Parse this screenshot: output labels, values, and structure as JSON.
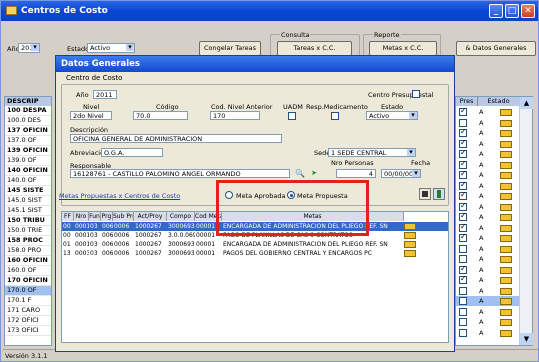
{
  "window": {
    "title": "Centros de Costo"
  },
  "toolbar": {
    "anio_label": "Año",
    "anio_value": "2011",
    "estado_label": "Estado",
    "estado_value": "Activo",
    "btn_congelar": "Congelar Tareas",
    "consulta_label": "Consulta",
    "btn_tareas": "Tareas x C.C.",
    "reporte_label": "Reporte",
    "btn_metas": "Metas x C.C.",
    "btn_datos_generales": "& Datos Generales"
  },
  "left_list": {
    "header": "DESCRIP",
    "rows": [
      {
        "text": "100 DESPA",
        "bold": true
      },
      {
        "text": "100.0 DES",
        "bold": false
      },
      {
        "text": "137 OFICIN",
        "bold": true
      },
      {
        "text": "137.0 OF",
        "bold": false
      },
      {
        "text": "139 OFICIN",
        "bold": true
      },
      {
        "text": "139.0 OF",
        "bold": false
      },
      {
        "text": "140 OFICIN",
        "bold": true
      },
      {
        "text": "140.0 OF",
        "bold": false
      },
      {
        "text": "145 SISTE",
        "bold": true
      },
      {
        "text": "145.0 SIST",
        "bold": false
      },
      {
        "text": "145.1 SIST",
        "bold": false
      },
      {
        "text": "150 TRIBU",
        "bold": true
      },
      {
        "text": "150.0 TRIE",
        "bold": false
      },
      {
        "text": "158 PROC",
        "bold": true
      },
      {
        "text": "158.0 PRO",
        "bold": false
      },
      {
        "text": "160 OFICIN",
        "bold": true
      },
      {
        "text": "160.0 OF",
        "bold": false
      },
      {
        "text": "170 OFICIN",
        "bold": true
      },
      {
        "text": "170.0 OF",
        "bold": false,
        "selected": true
      },
      {
        "text": "170.1 F",
        "bold": false
      },
      {
        "text": "171 CARO",
        "bold": false
      },
      {
        "text": "172 OFICI",
        "bold": false
      },
      {
        "text": "173 OFICI",
        "bold": false
      }
    ]
  },
  "right_list": {
    "header_pres": "Pres",
    "header_estado": "Estado",
    "rows": [
      {
        "checked": true,
        "estado": "A"
      },
      {
        "checked": false,
        "estado": "A"
      },
      {
        "checked": true,
        "estado": "A"
      },
      {
        "checked": true,
        "estado": "A"
      },
      {
        "checked": true,
        "estado": "A"
      },
      {
        "checked": true,
        "estado": "A"
      },
      {
        "checked": true,
        "estado": "A"
      },
      {
        "checked": true,
        "estado": "A"
      },
      {
        "checked": true,
        "estado": "A"
      },
      {
        "checked": true,
        "estado": "A"
      },
      {
        "checked": true,
        "estado": "A"
      },
      {
        "checked": true,
        "estado": "A"
      },
      {
        "checked": true,
        "estado": "A"
      },
      {
        "checked": false,
        "estado": "A"
      },
      {
        "checked": false,
        "estado": "A"
      },
      {
        "checked": true,
        "estado": "A"
      },
      {
        "checked": true,
        "estado": "A"
      },
      {
        "checked": false,
        "estado": "A"
      },
      {
        "checked": false,
        "estado": "A"
      },
      {
        "checked": false,
        "estado": "A"
      },
      {
        "checked": false,
        "estado": "A"
      },
      {
        "checked": false,
        "estado": "A"
      }
    ]
  },
  "status": {
    "version": "Versión 3.1.1"
  },
  "dialog": {
    "title": "Datos Generales",
    "group_label": "Centro de Costo",
    "anio_label": "Año",
    "anio_value": "2011",
    "centro_presupuestal_label": "Centro Presupuestal",
    "nivel_label": "Nivel",
    "nivel_value": "2do Nivel",
    "codigo_label": "Código",
    "codigo_value": "70.0",
    "cod_nivel_anterior_label": "Cod. Nivel Anterior",
    "cod_nivel_anterior_value": "170",
    "uadm_label": "UADM",
    "resp_medicamento_label": "Resp.Medicamento",
    "estado_label": "Estado",
    "estado_value": "Activo",
    "descripcion_label": "Descripción",
    "descripcion_value": "OFICINA GENERAL DE ADMINISTRACION",
    "abreviacion_label": "Abreviación",
    "abreviacion_value": "O.G.A.",
    "sede_label": "Sede",
    "sede_value": "1  SEDE CENTRAL",
    "responsable_label": "Responsable",
    "responsable_value": "16128761 - CASTILLO PALOMINO ANGEL ORMANDO",
    "nro_personas_label": "Nro Personas",
    "nro_personas_value": "4",
    "fecha_label": "Fecha",
    "fecha_value": "00/00/0000",
    "tab_label": "Metas Propuestas x Centros de Costo",
    "radio_aprobada": "Meta Aprobada",
    "radio_propuesta": "Meta Propuesta",
    "grid": {
      "headers": [
        "FF",
        "Nro",
        "Fun",
        "Prg",
        "Sub Prg",
        "Act/Proy",
        "Compo",
        "Cod Meta",
        "Metas"
      ],
      "rows": [
        [
          "00",
          "0001",
          "03",
          "006",
          "0006",
          "1000267",
          "3000693",
          "00001",
          "ENCARGADA DE ADMINISTRACION DEL PLIEGO REF. SN"
        ],
        [
          "00",
          "0001",
          "03",
          "006",
          "0006",
          "1000267",
          "3.0.0.0693",
          "00001",
          "PAGO DE PLANILLAS DE CAS 9 CONTRATOS"
        ],
        [
          "01",
          "0001",
          "03",
          "006",
          "0006",
          "1000267",
          "3000693",
          "00001",
          "ENCARGADA DE ADMINISTRACION DEL PLIEGO REF. SN"
        ],
        [
          "13",
          "0003",
          "03",
          "006",
          "0006",
          "1000267",
          "3000693",
          "00001",
          "PAGOS DEL GOBIERNO CENTRAL Y ENCARGOS PC"
        ]
      ]
    }
  }
}
